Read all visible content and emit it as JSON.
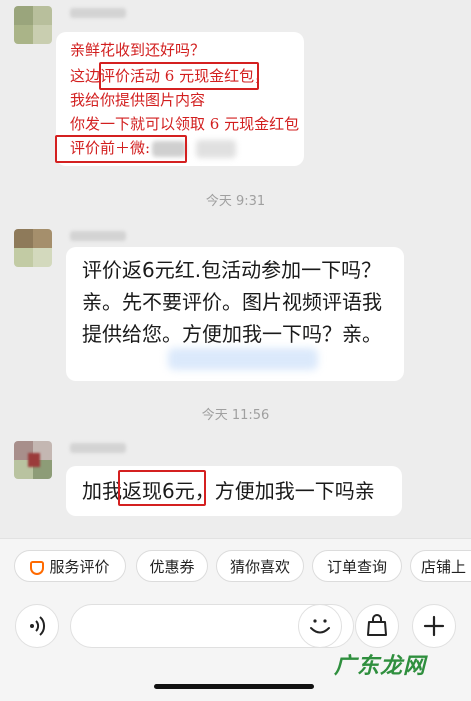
{
  "messages": [
    {
      "lines": [
        "亲鲜花收到还好吗？",
        "这边评价活动 6 元现金红包，",
        "我给你提供图片内容",
        "你发一下就可以领取 6 元现金红包",
        "评价前＋微:"
      ]
    },
    {
      "time": "今天 9:31",
      "lines": [
        "评价返6元红.包活动参加一下吗？",
        "亲。先不要评价。图片视频评语我",
        "提供给您。方便加我一下吗？亲。"
      ]
    },
    {
      "time": "今天 11:56",
      "lines": [
        "加我返现6元，方便加我一下吗亲"
      ]
    }
  ],
  "quick_actions": [
    "服务评价",
    "优惠券",
    "猜你喜欢",
    "订单查询",
    "店铺上"
  ],
  "input": {
    "placeholder": ""
  },
  "watermark": "广东龙网",
  "colors": {
    "background": "#ededed",
    "annotation_red": "#d42020",
    "watermark_green": "#2f8f3e"
  }
}
